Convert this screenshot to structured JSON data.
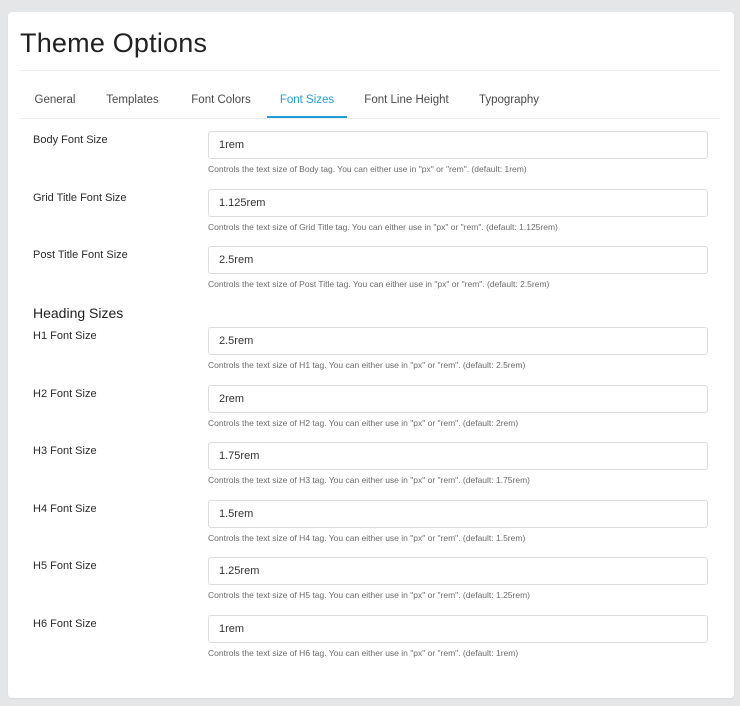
{
  "page": {
    "title": "Theme Options"
  },
  "tabs": [
    {
      "label": "General",
      "active": false
    },
    {
      "label": "Templates",
      "active": false
    },
    {
      "label": "Font Colors",
      "active": false
    },
    {
      "label": "Font Sizes",
      "active": true
    },
    {
      "label": "Font Line Height",
      "active": false
    },
    {
      "label": "Typography",
      "active": false
    }
  ],
  "colors": {
    "accent": "#1f9ed8",
    "background": "#e5e6e8",
    "panel": "#ffffff"
  },
  "fields": [
    {
      "label": "Body Font Size",
      "value": "1rem",
      "help": "Controls the text size of Body tag. You can either use in \"px\" or \"rem\". (default: 1rem)"
    },
    {
      "label": "Grid Title Font Size",
      "value": "1.125rem",
      "help": "Controls the text size of Grid Title tag. You can either use in \"px\" or \"rem\". (default: 1.125rem)"
    },
    {
      "label": "Post Title Font Size",
      "value": "2.5rem",
      "help": "Controls the text size of Post Title tag. You can either use in \"px\" or \"rem\". (default: 2.5rem)"
    }
  ],
  "heading_section": {
    "title": "Heading Sizes"
  },
  "heading_fields": [
    {
      "label": "H1 Font Size",
      "value": "2.5rem",
      "help": "Controls the text size of H1 tag. You can either use in \"px\" or \"rem\". (default: 2.5rem)"
    },
    {
      "label": "H2 Font Size",
      "value": "2rem",
      "help": "Controls the text size of H2 tag. You can either use in \"px\" or \"rem\". (default: 2rem)"
    },
    {
      "label": "H3 Font Size",
      "value": "1.75rem",
      "help": "Controls the text size of H3 tag. You can either use in \"px\" or \"rem\". (default: 1.75rem)"
    },
    {
      "label": "H4 Font Size",
      "value": "1.5rem",
      "help": "Controls the text size of H4 tag. You can either use in \"px\" or \"rem\". (default: 1.5rem)"
    },
    {
      "label": "H5 Font Size",
      "value": "1.25rem",
      "help": "Controls the text size of H5 tag. You can either use in \"px\" or \"rem\". (default: 1.25rem)"
    },
    {
      "label": "H6 Font Size",
      "value": "1rem",
      "help": "Controls the text size of H6 tag. You can either use in \"px\" or \"rem\". (default: 1rem)"
    }
  ]
}
